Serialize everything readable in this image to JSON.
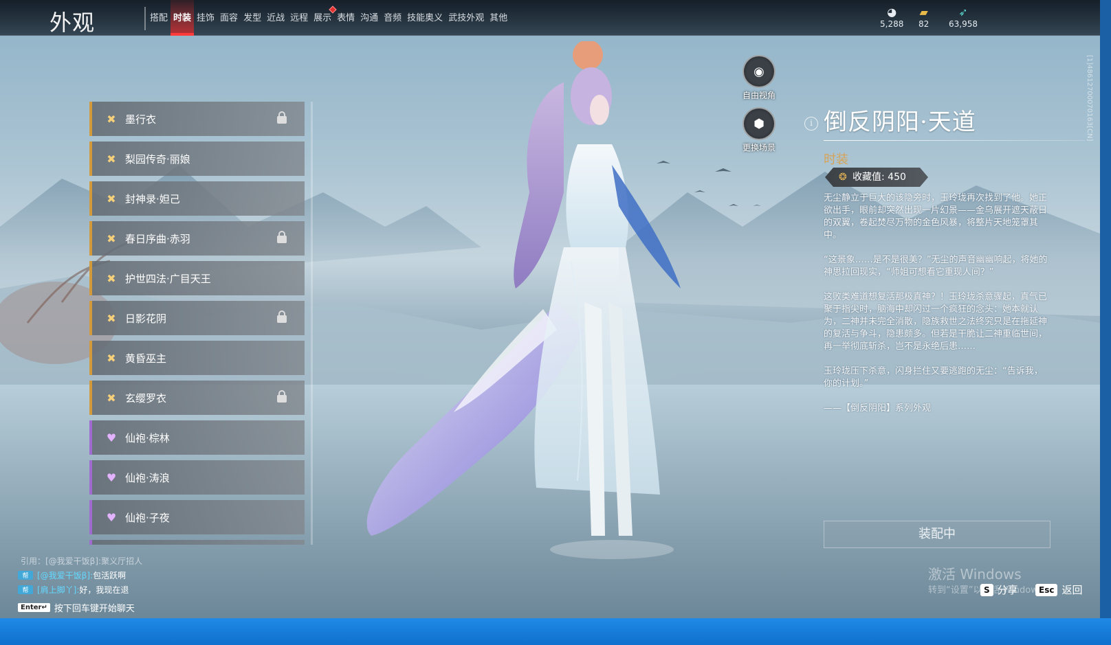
{
  "header": {
    "title": "外观",
    "tabs": [
      "搭配",
      "时装",
      "挂饰",
      "面容",
      "发型",
      "近战",
      "远程",
      "展示",
      "表情",
      "沟通",
      "音频",
      "技能奥义",
      "武技外观",
      "其他"
    ],
    "active_tab": "时装",
    "notify_tab": "展示"
  },
  "currencies": [
    {
      "icon": "mask-currency-icon",
      "value": "5,288"
    },
    {
      "icon": "ticket-currency-icon",
      "value": "82"
    },
    {
      "icon": "feather-currency-icon",
      "value": "63,958"
    }
  ],
  "outfit_list": [
    {
      "label": "墨行衣",
      "rarity": "gold",
      "locked": true
    },
    {
      "label": "梨园传奇·丽娘",
      "rarity": "gold",
      "locked": false
    },
    {
      "label": "封神录·妲己",
      "rarity": "gold",
      "locked": false
    },
    {
      "label": "春日序曲·赤羽",
      "rarity": "gold",
      "locked": true
    },
    {
      "label": "护世四法·广目天王",
      "rarity": "gold",
      "locked": false
    },
    {
      "label": "日影花阴",
      "rarity": "gold",
      "locked": true
    },
    {
      "label": "黄昏巫主",
      "rarity": "gold",
      "locked": false
    },
    {
      "label": "玄缨罗衣",
      "rarity": "gold",
      "locked": true
    },
    {
      "label": "仙袍·棕林",
      "rarity": "purple",
      "locked": false
    },
    {
      "label": "仙袍·涛浪",
      "rarity": "purple",
      "locked": false
    },
    {
      "label": "仙袍·子夜",
      "rarity": "purple",
      "locked": false
    }
  ],
  "controls": {
    "free_view_label": "自由视角",
    "change_scene_label": "更换场景"
  },
  "detail": {
    "name": "倒反阴阳·天道",
    "category": "时装",
    "collect_label": "收藏值: 450",
    "paragraphs": [
      "无尘静立于巨大的该隐旁时，玉玲珑再次找到了他。她正欲出手，眼前却突然出现一片幻景——金乌展开遮天蔽日的双翼，卷起焚尽万物的金色风暴，将整片天地笼罩其中。",
      "“这景象……是不是很美？”无尘的声音幽幽响起，将她的神思拉回现实，“师姐可想看它重现人间？”",
      "这败类难道想复活那极真神？！玉玲珑杀意骤起，真气已聚于指尖时，脑海中却闪过一个疯狂的念头：她本就认为，二神并未完全消散，隐族救世之法终究只是在拖延神的复活与争斗，隐患颇多。但若是干脆让二神重临世间，再一举彻底斩杀，岂不是永绝后患……",
      "玉玲珑压下杀意，闪身拦住又要逃跑的无尘：“告诉我，你的计划。”",
      "——【倒反阴阳】系列外观"
    ],
    "equip_label": "装配中"
  },
  "chat": {
    "quote": "引用：[@我爱干饭β]:聚义厅招人",
    "messages": [
      {
        "name": "[@我爱干饭β]:",
        "text": "包活跃啊"
      },
      {
        "name": "[肩上脚丫]:",
        "text": "好，我现在退"
      }
    ],
    "enter_key": "Enter↵",
    "enter_hint": "按下回车键开始聊天"
  },
  "footer": {
    "watermark": "激活 Windows",
    "watermark_sub": "转到“设置”以激活 Windows。",
    "share_key": "S",
    "share_label": "分享",
    "back_key": "Esc",
    "back_label": "返回",
    "side_id": "[1]48612700070163[CN]"
  },
  "colors": {
    "active_tab": "#ff3b3b",
    "gold_rarity": "#d39a3b",
    "purple_rarity": "#a06bd1",
    "category": "#d6a458",
    "chat_name": "#64d8ff"
  }
}
